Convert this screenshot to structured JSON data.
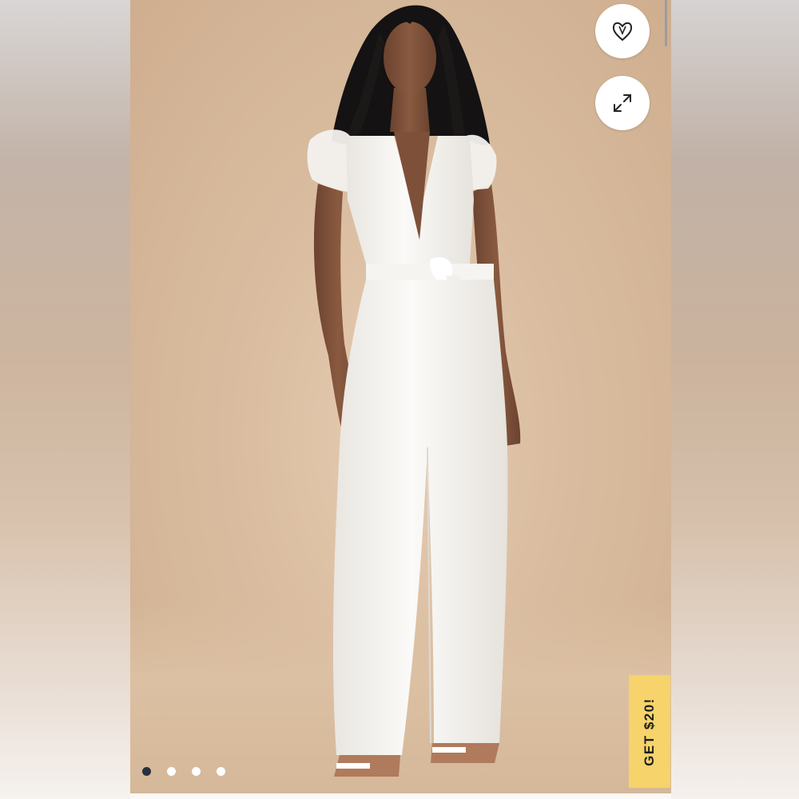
{
  "promo": {
    "label": "GET $20!"
  },
  "actions": {
    "favorite_icon": "heart-icon",
    "expand_icon": "expand-icon"
  },
  "gallery": {
    "total_images": 4,
    "active_index": 0
  },
  "colors": {
    "promo_bg": "#f6d36b",
    "active_dot": "#28303d",
    "inactive_dot": "#ffffff",
    "garment": "#f8f6f2",
    "backdrop": "#d9bc9f"
  }
}
